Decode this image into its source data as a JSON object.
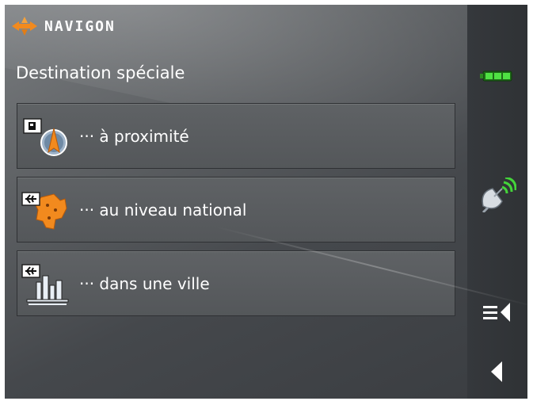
{
  "header": {
    "brand": "NAVIGON",
    "title": "Destination spéciale"
  },
  "menu": {
    "items": [
      {
        "label": "··· à proximité",
        "icon": "poi-nearby-icon"
      },
      {
        "label": "··· au niveau national",
        "icon": "poi-national-icon"
      },
      {
        "label": "··· dans une ville",
        "icon": "poi-city-icon"
      }
    ]
  },
  "sidebar": {
    "battery_icon": "battery-icon",
    "gps_icon": "gps-satellite-icon",
    "menu_icon": "menu-icon",
    "back_icon": "back-icon"
  },
  "colors": {
    "accent_orange": "#f28a1e",
    "battery_green": "#3fc83a",
    "panel": "#5a5d60"
  }
}
